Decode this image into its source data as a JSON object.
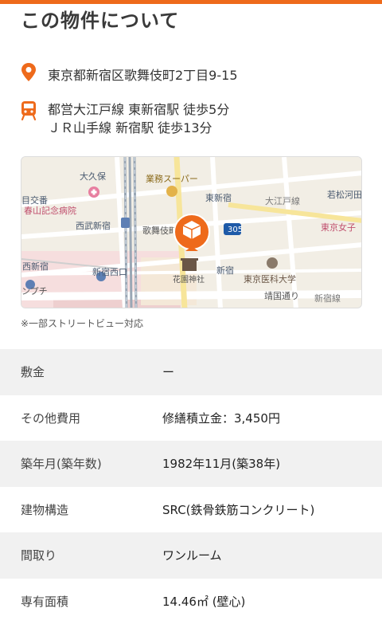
{
  "title": "この物件について",
  "address": {
    "icon": "location-pin-icon",
    "text": "東京都新宿区歌舞伎町2丁目9-15"
  },
  "access": {
    "icon": "train-icon",
    "lines": [
      "都営大江戸線 東新宿駅 徒歩5分",
      "ＪＲ山手線 新宿駅 徒歩13分"
    ]
  },
  "map": {
    "labels": {
      "okubo": "大久保",
      "gyomu": "業務スーパー",
      "higashishinjuku": "東新宿",
      "oedo": "大江戸線",
      "wakamatsu": "若松河田",
      "menkoujou": "目交番",
      "haruyama": "春山記念病院",
      "seibu": "西武新宿",
      "kabukicho": "歌舞伎町",
      "route": "305",
      "tokyojoshi": "東京女子",
      "nishishinjuku": "西新宿",
      "shinjukunishiguchi": "新宿西口",
      "hanazono": "花園神社",
      "shinjuku": "新宿",
      "ikadaigaku": "東京医科大学",
      "yasukuni": "靖国通り",
      "shinjukusen": "新宿線",
      "nfuchi": "ンプチ"
    }
  },
  "note": "※一部ストリートビュー対応",
  "details": [
    {
      "key": "敷金",
      "value": "ー"
    },
    {
      "key": "その他費用",
      "value": "修繕積立金：3,450円"
    },
    {
      "key": "築年月(築年数)",
      "value": "1982年11月(築38年)"
    },
    {
      "key": "建物構造",
      "value": "SRC(鉄骨鉄筋コンクリート)"
    },
    {
      "key": "間取り",
      "value": "ワンルーム"
    },
    {
      "key": "専有面積",
      "value": "14.46㎡ (壁心)"
    }
  ],
  "colors": {
    "accent": "#ee6a1b",
    "rowAlt": "#f1f1f1"
  }
}
